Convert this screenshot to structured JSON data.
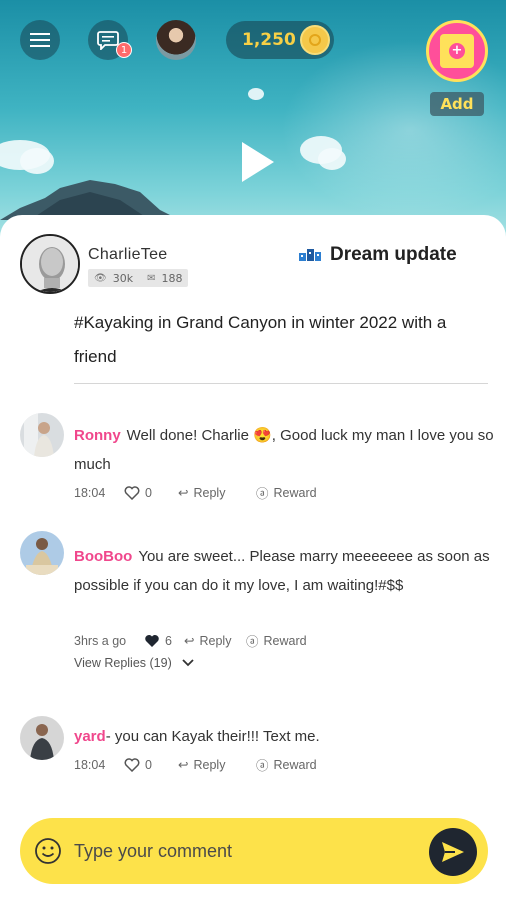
{
  "header": {
    "notification_count": "1",
    "coins": "1,250",
    "add_label": "Add"
  },
  "post": {
    "author": "CharlieTee",
    "views": "30k",
    "comments_count": "188",
    "dream_label": "Dream update",
    "text": "#Kayaking in Grand Canyon in winter 2022 with a friend"
  },
  "comments": [
    {
      "user": "Ronny",
      "text": "Well done! Charlie 😍, Good luck my man I love you so much",
      "time": "18:04",
      "likes": "0",
      "reply_label": "Reply",
      "reward_label": "Reward"
    },
    {
      "user": "BooBoo",
      "text": "You are sweet... Please marry meeeeeee as soon as possible if you can do it my love, I am waiting!#$$",
      "time": "3hrs a go",
      "likes": "6",
      "reply_label": "Reply",
      "reward_label": "Reward",
      "view_replies": "View Replies (19)"
    },
    {
      "user": "yard",
      "text": "- you can Kayak their!!! Text me.",
      "time": "18:04",
      "likes": "0",
      "reply_label": "Reply",
      "reward_label": "Reward"
    }
  ],
  "composer": {
    "placeholder": "Type your comment"
  },
  "colors": {
    "accent_pink": "#f0478c",
    "composer_yellow": "#fde24a",
    "send_dark": "#1f2630"
  }
}
